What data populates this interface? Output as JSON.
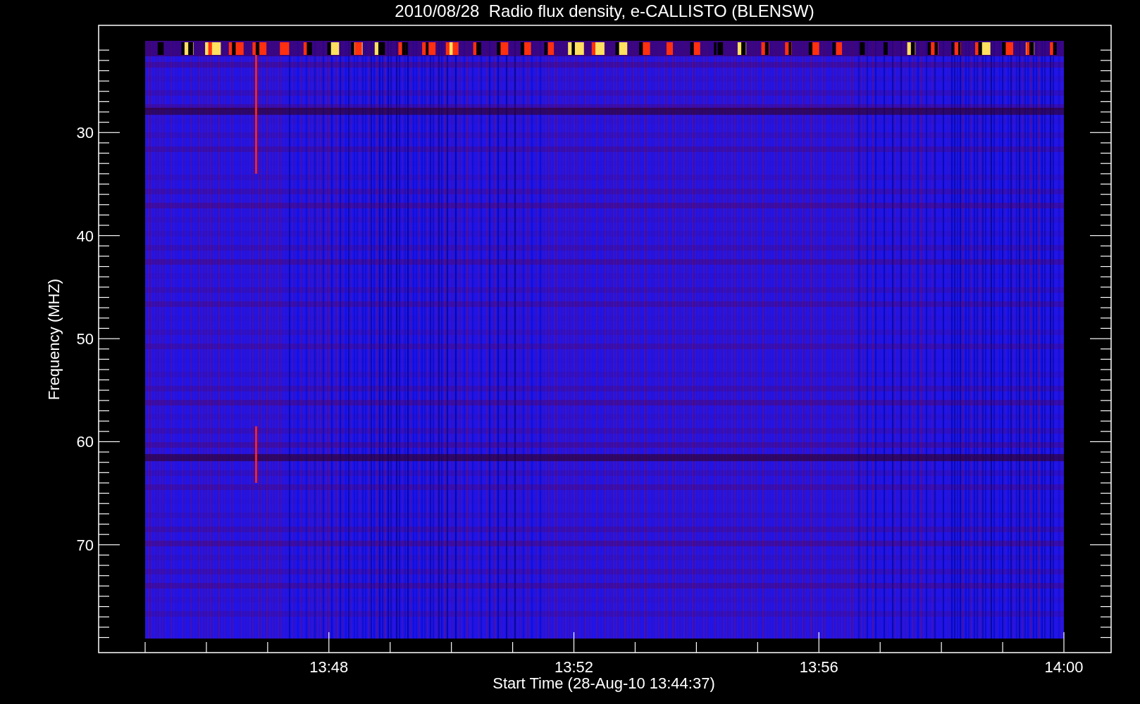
{
  "title": "2010/08/28  Radio flux density, e-CALLISTO (BLENSW)",
  "chart": {
    "ylabel": "Frequency (MHZ)",
    "xlabel": "Start Time (28-Aug-10 13:44:37)",
    "yticks": [
      "30",
      "40",
      "50",
      "60",
      "70"
    ],
    "xticks": [
      "13:48",
      "13:52",
      "13:56",
      "14:00"
    ]
  }
}
